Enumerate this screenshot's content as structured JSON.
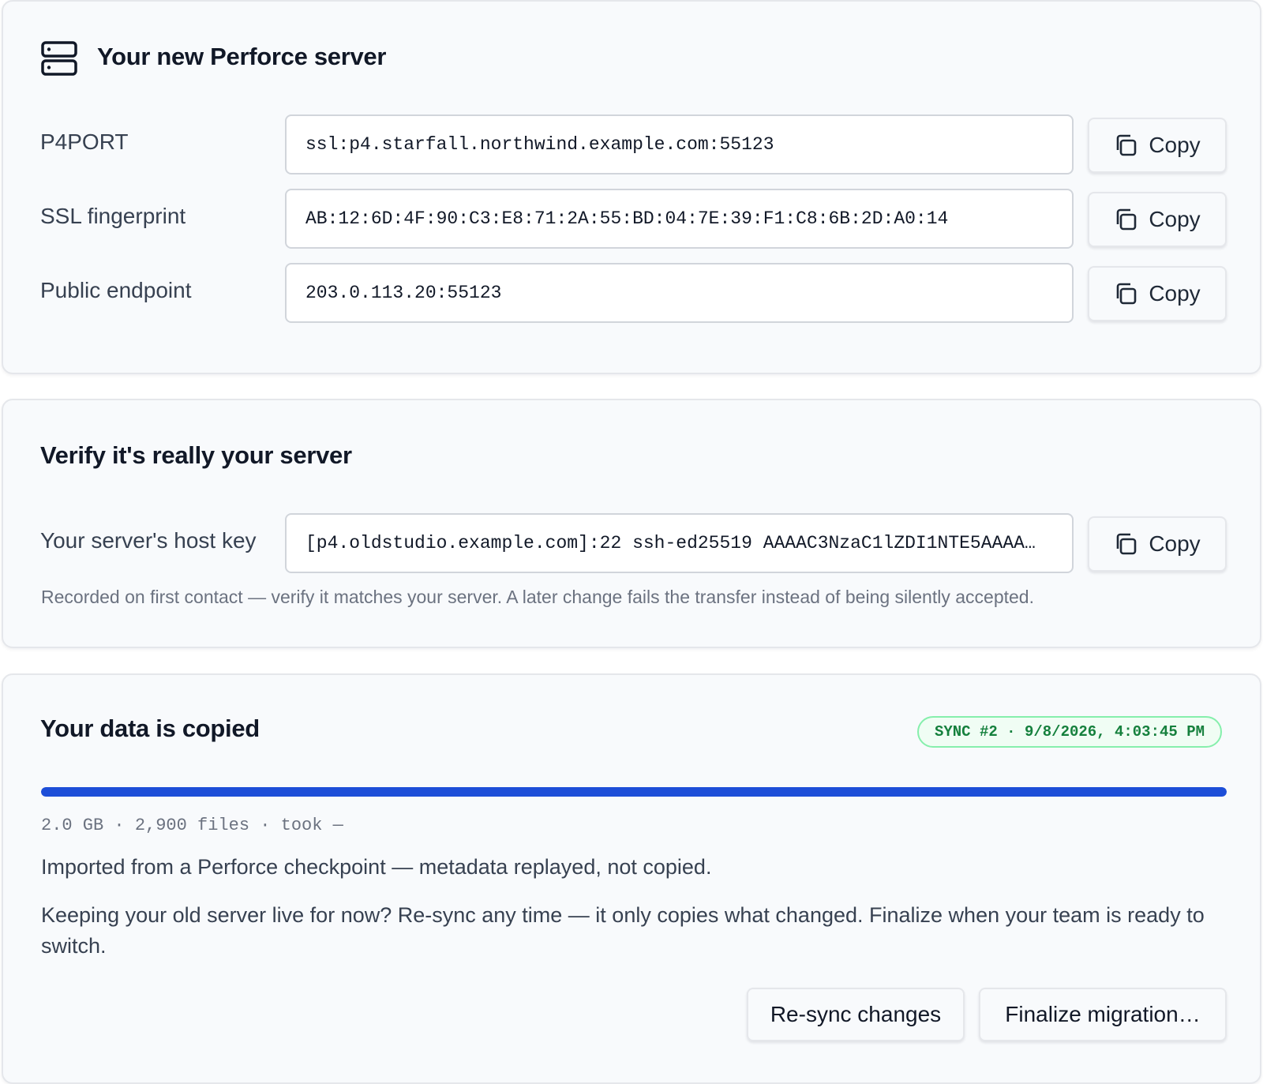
{
  "server": {
    "title": "Your new Perforce server",
    "icon": "server-icon",
    "rows": [
      {
        "label": "P4PORT",
        "value": "ssl:p4.starfall.northwind.example.com:55123",
        "copy_label": "Copy"
      },
      {
        "label": "SSL fingerprint",
        "value": "AB:12:6D:4F:90:C3:E8:71:2A:55:BD:04:7E:39:F1:C8:6B:2D:A0:14",
        "copy_label": "Copy"
      },
      {
        "label": "Public endpoint",
        "value": "203.0.113.20:55123",
        "copy_label": "Copy"
      }
    ]
  },
  "verify": {
    "title": "Verify it's really your server",
    "host_key_label": "Your server's host key",
    "host_key_value": "[p4.oldstudio.example.com]:22 ssh-ed25519 AAAAC3NzaC1lZDI1NTE5AAAA…",
    "copy_label": "Copy",
    "note": "Recorded on first contact — verify it matches your server. A later change fails the transfer instead of being silently accepted."
  },
  "data": {
    "title": "Your data is copied",
    "sync_badge": "SYNC #2 · 9/8/2026, 4:03:45 PM",
    "progress_percent": 100,
    "stats": "2.0 GB · 2,900 files · took —",
    "imported_text": "Imported from a Perforce checkpoint — metadata replayed, not copied.",
    "resync_text": "Keeping your old server live for now? Re-sync any time — it only copies what changed. Finalize when your team is ready to switch.",
    "resync_button": "Re-sync changes",
    "finalize_button": "Finalize migration…"
  },
  "colors": {
    "accent": "#1d4ed8",
    "badge_text": "#15803d",
    "badge_border": "#86efac"
  }
}
